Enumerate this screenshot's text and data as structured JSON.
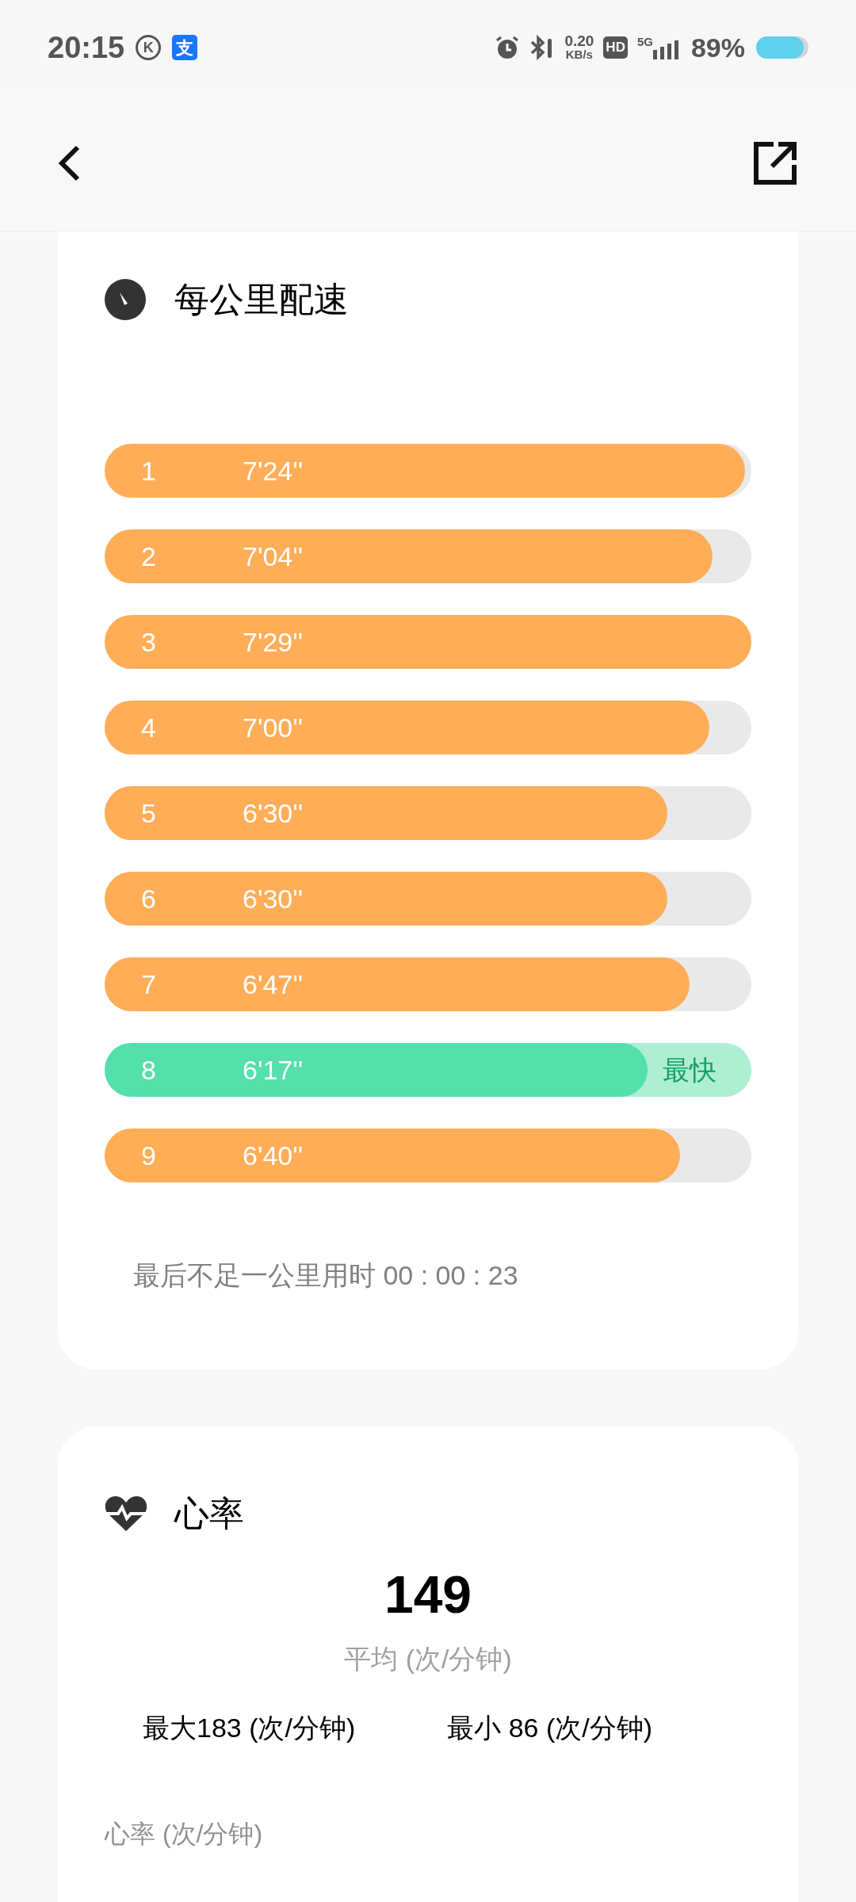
{
  "status_bar": {
    "time": "20:15",
    "app_icons": [
      "K",
      "支"
    ],
    "network_speed": [
      "0.20",
      "KB/s"
    ],
    "hd": "HD",
    "network": "5G",
    "battery": "89%"
  },
  "pace_card": {
    "title": "每公里配速",
    "splits": [
      {
        "km": "1",
        "pace": "7'24''",
        "level": 0.99,
        "fastest": false
      },
      {
        "km": "2",
        "pace": "7'04''",
        "level": 0.94,
        "fastest": false
      },
      {
        "km": "3",
        "pace": "7'29''",
        "level": 1,
        "fastest": false
      },
      {
        "km": "4",
        "pace": "7'00''",
        "level": 0.935,
        "fastest": false
      },
      {
        "km": "5",
        "pace": "6'30''",
        "level": 0.87,
        "fastest": false
      },
      {
        "km": "6",
        "pace": "6'30''",
        "level": 0.87,
        "fastest": false
      },
      {
        "km": "7",
        "pace": "6'47''",
        "level": 0.905,
        "fastest": false
      },
      {
        "km": "8",
        "pace": "6'17''",
        "level": 0.84,
        "fastest": true,
        "badge": "最快"
      },
      {
        "km": "9",
        "pace": "6'40''",
        "level": 0.89,
        "fastest": false
      }
    ],
    "footnote": "最后不足一公里用时 00 : 00 : 23"
  },
  "heart_rate_card": {
    "title": "心率",
    "average": "149",
    "average_label": "平均 (次/分钟)",
    "max": "最大183 (次/分钟)",
    "min": "最小 86 (次/分钟)",
    "chart_label": "心率 (次/分钟)"
  }
}
